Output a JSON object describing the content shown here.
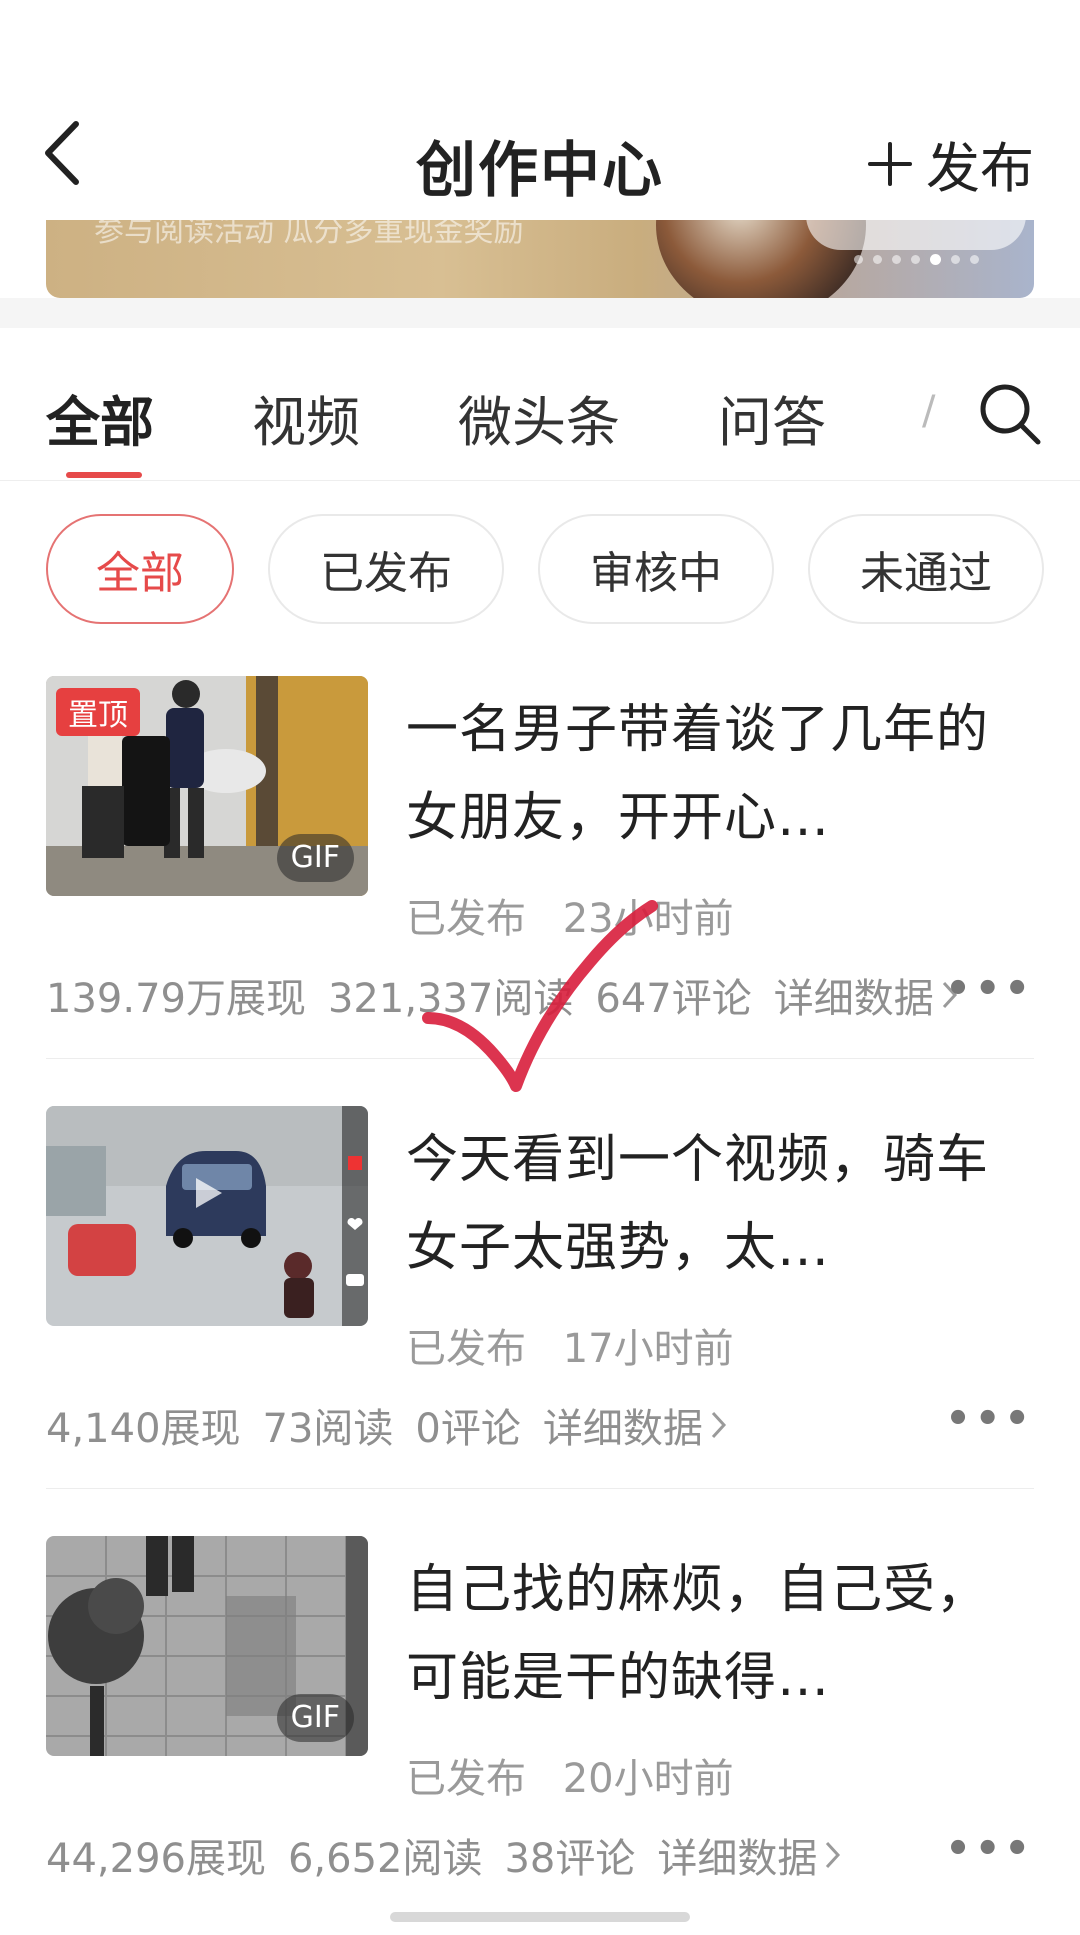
{
  "header": {
    "title": "创作中心",
    "publish_label": "发布"
  },
  "banner": {
    "text": "参与阅读活动 瓜分多重现金奖励",
    "dots": 7,
    "active_dot": 5
  },
  "tabs": [
    {
      "label": "全部"
    },
    {
      "label": "视频"
    },
    {
      "label": "微头条"
    },
    {
      "label": "问答"
    }
  ],
  "tabs_overflow_glyph": "/",
  "filters": [
    {
      "label": "全部"
    },
    {
      "label": "已发布"
    },
    {
      "label": "审核中"
    },
    {
      "label": "未通过"
    }
  ],
  "posts": [
    {
      "title": "一名男子带着谈了几年的女朋友，开开心…",
      "status": "已发布",
      "time": "23小时前",
      "impressions": "139.79万展现",
      "reads": "321,337阅读",
      "comments": "647评论",
      "detail_label": "详细数据",
      "pin_label": "置顶",
      "media_badge": "GIF"
    },
    {
      "title": "今天看到一个视频，骑车女子太强势，太…",
      "status": "已发布",
      "time": "17小时前",
      "impressions": "4,140展现",
      "reads": "73阅读",
      "comments": "0评论",
      "detail_label": "详细数据"
    },
    {
      "title": "自己找的麻烦，自己受，可能是干的缺得…",
      "status": "已发布",
      "time": "20小时前",
      "impressions": "44,296展现",
      "reads": "6,652阅读",
      "comments": "38评论",
      "detail_label": "详细数据",
      "media_badge": "GIF"
    }
  ],
  "more_glyph": "•••",
  "colors": {
    "accent": "#e64a4a",
    "meta_text": "#9a9a9a",
    "check_mark": "#d81e3c"
  }
}
